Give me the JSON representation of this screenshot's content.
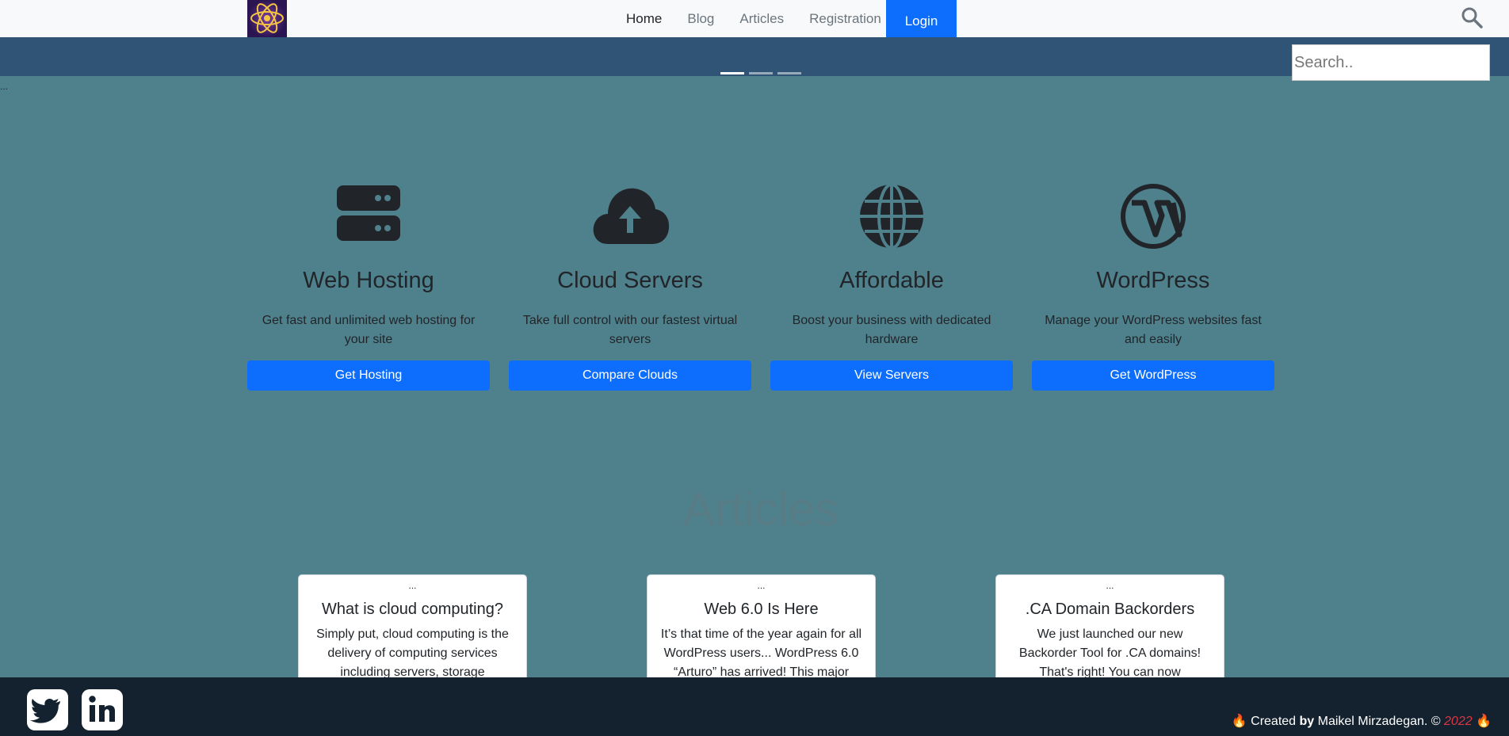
{
  "nav": {
    "links": [
      "Home",
      "Blog",
      "Articles",
      "Registration"
    ],
    "login": "Login"
  },
  "search": {
    "placeholder": "Search.."
  },
  "carousel": {
    "alt_text": "..."
  },
  "features": [
    {
      "icon": "server-icon",
      "title": "Web Hosting",
      "description": "Get fast and unlimited web hosting for your site",
      "button": "Get Hosting"
    },
    {
      "icon": "cloud-upload-icon",
      "title": "Cloud Servers",
      "description": "Take full control with our fastest virtual servers",
      "button": "Compare Clouds"
    },
    {
      "icon": "globe-icon",
      "title": "Affordable",
      "description": "Boost your business with dedicated hardware",
      "button": "View Servers"
    },
    {
      "icon": "wordpress-icon",
      "title": "WordPress",
      "description": "Manage your WordPress websites fast and easily",
      "button": "Get WordPress"
    }
  ],
  "articles": {
    "heading": "Articles",
    "cards": [
      {
        "image_alt": "...",
        "title": "What is cloud computing?",
        "text": "Simply put, cloud computing is the delivery of computing services including servers, storage"
      },
      {
        "image_alt": "...",
        "title": "Web 6.0 Is Here",
        "text": "It’s that time of the year again for all WordPress users... WordPress 6.0 “Arturo” has arrived! This major release"
      },
      {
        "image_alt": "...",
        "title": ".CA Domain Backorders",
        "text": "We just launched our new Backorder Tool for .CA domains! That's right! You can now"
      }
    ]
  },
  "footer": {
    "social": [
      "twitter-icon",
      "linkedin-icon"
    ],
    "credit_prefix": "🔥 Created ",
    "credit_by": "by",
    "credit_name": " Maikel Mirzadegan. © ",
    "credit_year": "2022",
    "credit_suffix": " 🔥"
  },
  "colors": {
    "primary": "#0d6efd",
    "page_background": "#4f818c",
    "carousel_background": "#2f5475",
    "footer_background": "#13222e"
  }
}
